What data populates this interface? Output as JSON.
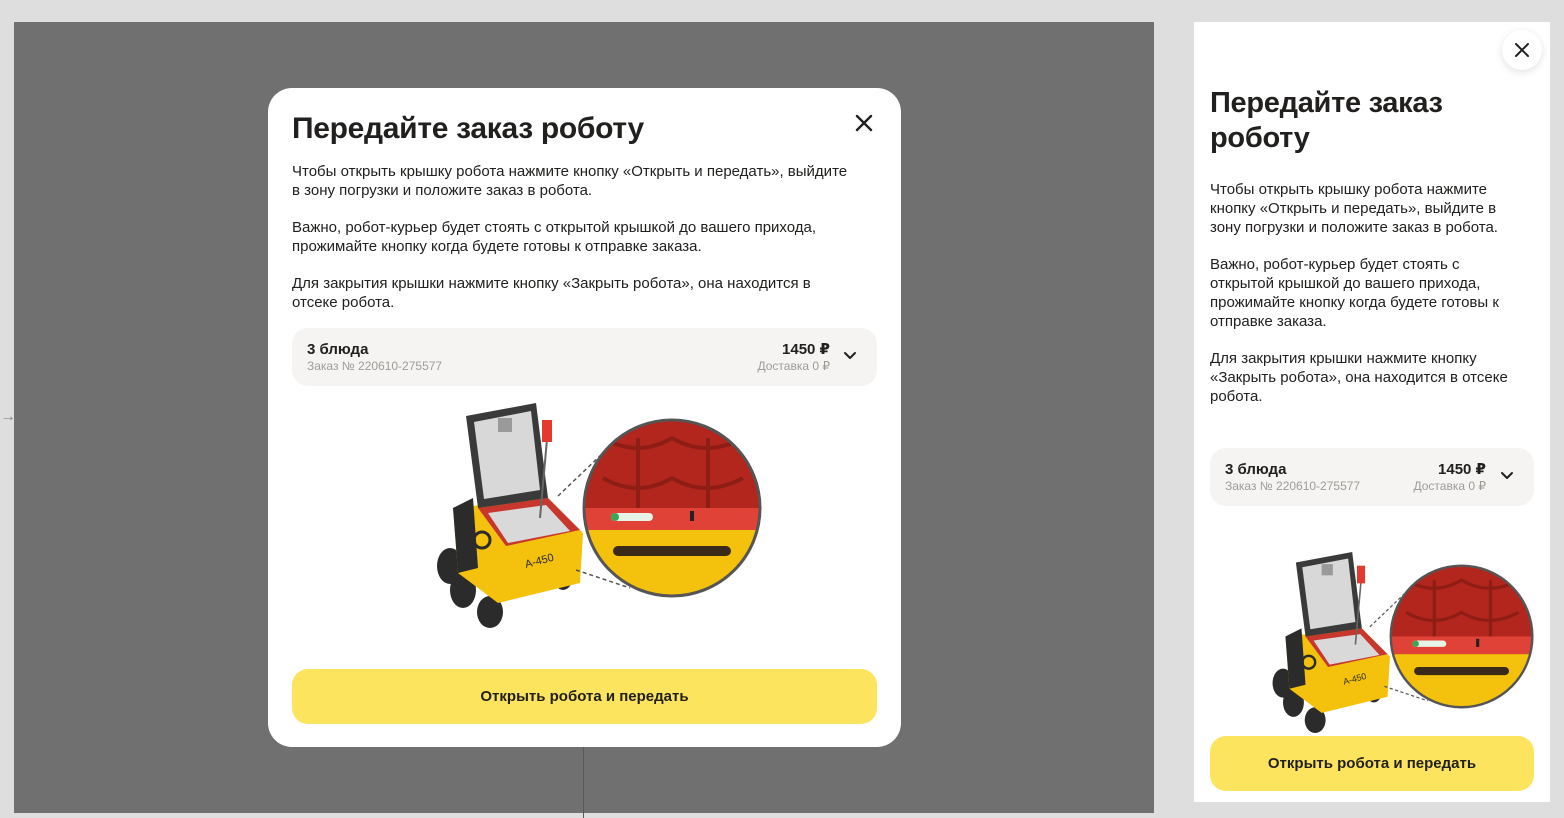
{
  "modal": {
    "title": "Передайте заказ роботу",
    "paragraphs": [
      "Чтобы открыть крышку робота нажмите кнопку «Открыть и передать», выйдите в зону погрузки и положите заказ в робота.",
      "Важно, робот-курьер будет стоять с открытой крышкой до вашего прихода, прожимайте кнопку когда будете готовы к отправке заказа.",
      "Для закрытия крышки нажмите кнопку «Закрыть робота», она находится в отсеке робота."
    ],
    "order": {
      "dishes": "3 блюда",
      "number": "Заказ № 220610-275577",
      "price": "1450 ₽",
      "delivery": "Доставка 0 ₽"
    },
    "cta_label": "Открыть робота и передать"
  },
  "panel": {
    "title": "Передайте заказ роботу",
    "paragraphs": [
      "Чтобы открыть крышку робота нажмите кнопку «Открыть и передать», выйдите в зону погрузки и положите заказ в робота.",
      "Важно, робот-курьер будет стоять с открытой крышкой до вашего прихода, прожимайте кнопку когда будете готовы к отправке заказа.",
      "Для закрытия крышки нажмите кнопку «Закрыть робота», она находится в отсеке робота."
    ],
    "order": {
      "dishes": "3 блюда",
      "number": "Заказ № 220610-275577",
      "price": "1450 ₽",
      "delivery": "Доставка 0 ₽"
    },
    "cta_label": "Открыть робота и передать"
  },
  "robot_label": "A-450",
  "icons": {
    "close": "close-icon",
    "chevron": "chevron-down-icon",
    "arrow": "arrow-right-icon"
  },
  "colors": {
    "accent": "#fce45e",
    "overlay": "#707070",
    "robot_red": "#c8372d",
    "robot_yellow": "#f4c20d"
  }
}
